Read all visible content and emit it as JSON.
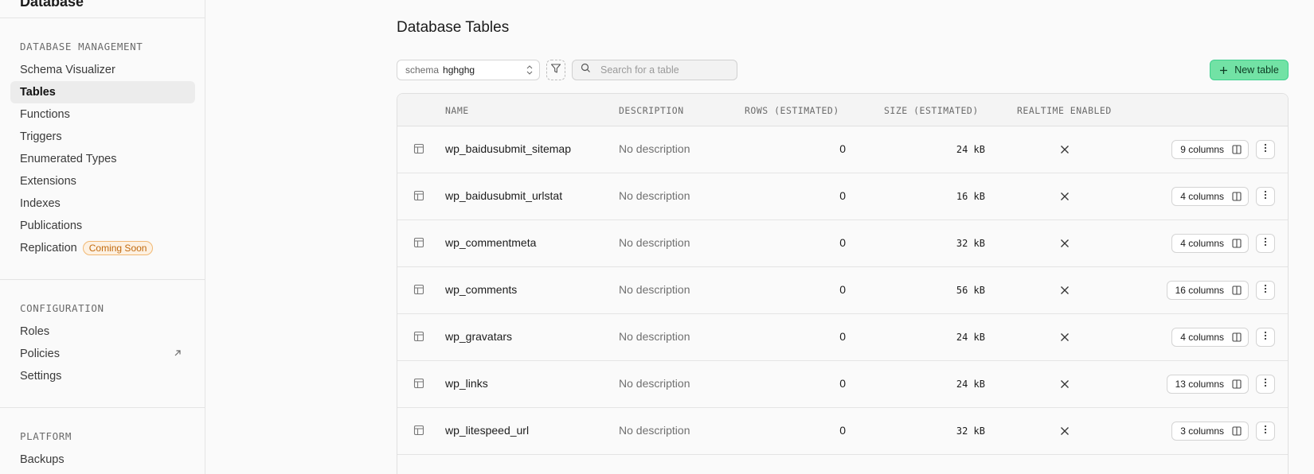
{
  "sidebar": {
    "title": "Database",
    "sections": [
      {
        "label": "DATABASE MANAGEMENT",
        "items": [
          {
            "label": "Schema Visualizer"
          },
          {
            "label": "Tables",
            "active": true
          },
          {
            "label": "Functions"
          },
          {
            "label": "Triggers"
          },
          {
            "label": "Enumerated Types"
          },
          {
            "label": "Extensions"
          },
          {
            "label": "Indexes"
          },
          {
            "label": "Publications"
          },
          {
            "label": "Replication",
            "badge": "Coming Soon"
          }
        ]
      },
      {
        "label": "CONFIGURATION",
        "items": [
          {
            "label": "Roles"
          },
          {
            "label": "Policies",
            "icon": "external-link-icon"
          },
          {
            "label": "Settings"
          }
        ]
      },
      {
        "label": "PLATFORM",
        "items": [
          {
            "label": "Backups"
          }
        ]
      }
    ]
  },
  "main": {
    "title": "Database Tables",
    "schema_select": {
      "prefix": "schema",
      "value": "hghghg"
    },
    "search": {
      "placeholder": "Search for a table",
      "value": ""
    },
    "new_table_label": "New table",
    "columns": [
      "NAME",
      "DESCRIPTION",
      "ROWS (ESTIMATED)",
      "SIZE (ESTIMATED)",
      "REALTIME ENABLED"
    ],
    "rows": [
      {
        "name": "wp_baidusubmit_sitemap",
        "description": "No description",
        "rows": "0",
        "size": "24 kB",
        "realtime": false,
        "columns": "9 columns"
      },
      {
        "name": "wp_baidusubmit_urlstat",
        "description": "No description",
        "rows": "0",
        "size": "16 kB",
        "realtime": false,
        "columns": "4 columns"
      },
      {
        "name": "wp_commentmeta",
        "description": "No description",
        "rows": "0",
        "size": "32 kB",
        "realtime": false,
        "columns": "4 columns"
      },
      {
        "name": "wp_comments",
        "description": "No description",
        "rows": "0",
        "size": "56 kB",
        "realtime": false,
        "columns": "16 columns"
      },
      {
        "name": "wp_gravatars",
        "description": "No description",
        "rows": "0",
        "size": "24 kB",
        "realtime": false,
        "columns": "4 columns"
      },
      {
        "name": "wp_links",
        "description": "No description",
        "rows": "0",
        "size": "24 kB",
        "realtime": false,
        "columns": "13 columns"
      },
      {
        "name": "wp_litespeed_url",
        "description": "No description",
        "rows": "0",
        "size": "32 kB",
        "realtime": false,
        "columns": "3 columns"
      }
    ]
  },
  "colors": {
    "accent": "#3fcf8e",
    "accent_fill": "#72e2a5",
    "badge": "#c26a0e"
  }
}
